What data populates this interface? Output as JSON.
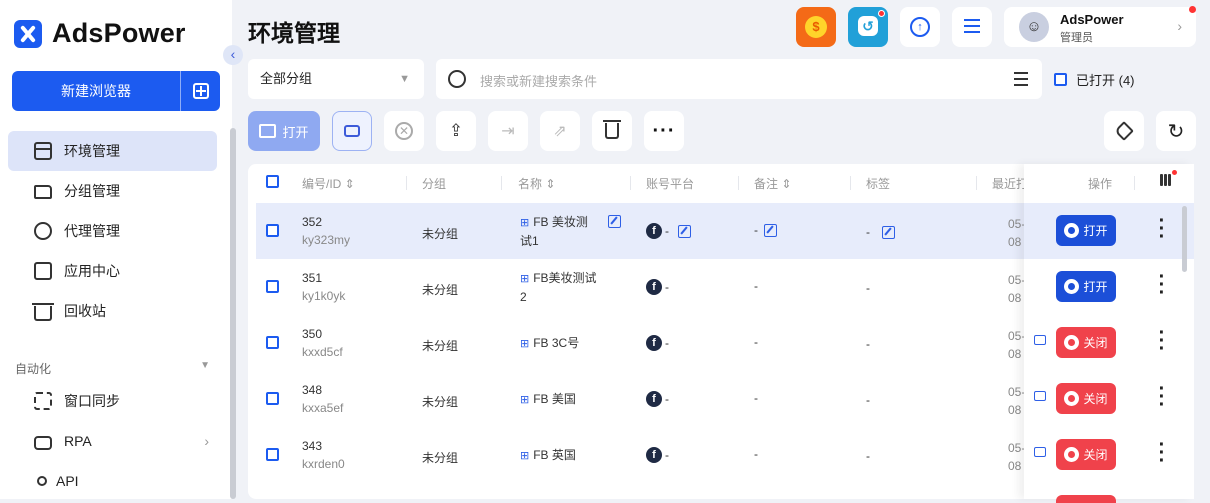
{
  "app": {
    "name": "AdsPower"
  },
  "sidebar": {
    "new_button": "新建浏览器",
    "items": [
      {
        "label": "环境管理",
        "icon": "window-icon",
        "active": true
      },
      {
        "label": "分组管理",
        "icon": "folder-icon"
      },
      {
        "label": "代理管理",
        "icon": "globe-icon"
      },
      {
        "label": "应用中心",
        "icon": "puzzle-icon"
      },
      {
        "label": "回收站",
        "icon": "trash-icon"
      }
    ],
    "automation_title": "自动化",
    "automation_items": [
      {
        "label": "窗口同步",
        "icon": "sync-icon"
      },
      {
        "label": "RPA",
        "icon": "robot-icon"
      },
      {
        "label": "API",
        "icon": "plug-icon"
      }
    ]
  },
  "header": {
    "title": "环境管理",
    "user": {
      "name": "AdsPower",
      "role": "管理员"
    }
  },
  "filters": {
    "group": "全部分组",
    "search_placeholder": "搜索或新建搜索条件",
    "opened_label": "已打开 (4)"
  },
  "toolbar": {
    "open_label": "打开"
  },
  "table": {
    "columns": [
      "编号/ID",
      "分组",
      "名称",
      "账号平台",
      "备注",
      "标签",
      "最近打开"
    ],
    "actions_header": "操作",
    "rows": [
      {
        "num": "352",
        "id": "ky323my",
        "group": "未分组",
        "name_line1": "FB 美妆测",
        "name_line2": "试1",
        "platform_suffix": "-",
        "note": "-",
        "tag": "-",
        "last1": "05-",
        "last2": "08",
        "action": "打开",
        "state": "open",
        "selected": true
      },
      {
        "num": "351",
        "id": "ky1k0yk",
        "group": "未分组",
        "name_line1": "FB美妆测试",
        "name_line2": "2",
        "platform_suffix": "-",
        "note": "-",
        "tag": "-",
        "last1": "05-",
        "last2": "08",
        "action": "打开",
        "state": "open",
        "selected": false
      },
      {
        "num": "350",
        "id": "kxxd5cf",
        "group": "未分组",
        "name_line1": "FB 3C号",
        "name_line2": "",
        "platform_suffix": "-",
        "note": "-",
        "tag": "-",
        "last1": "05-",
        "last2": "08",
        "action": "关闭",
        "state": "close",
        "selected": false
      },
      {
        "num": "348",
        "id": "kxxa5ef",
        "group": "未分组",
        "name_line1": "FB 美国",
        "name_line2": "",
        "platform_suffix": "-",
        "note": "-",
        "tag": "-",
        "last1": "05-",
        "last2": "08",
        "action": "关闭",
        "state": "close",
        "selected": false
      },
      {
        "num": "343",
        "id": "kxrden0",
        "group": "未分组",
        "name_line1": "FB 英国",
        "name_line2": "",
        "platform_suffix": "-",
        "note": "-",
        "tag": "-",
        "last1": "05-",
        "last2": "08",
        "action": "关闭",
        "state": "close",
        "selected": false
      }
    ]
  },
  "colors": {
    "primary": "#1c5bf0",
    "danger": "#f0424b",
    "selected_row": "#e7ecfb"
  }
}
